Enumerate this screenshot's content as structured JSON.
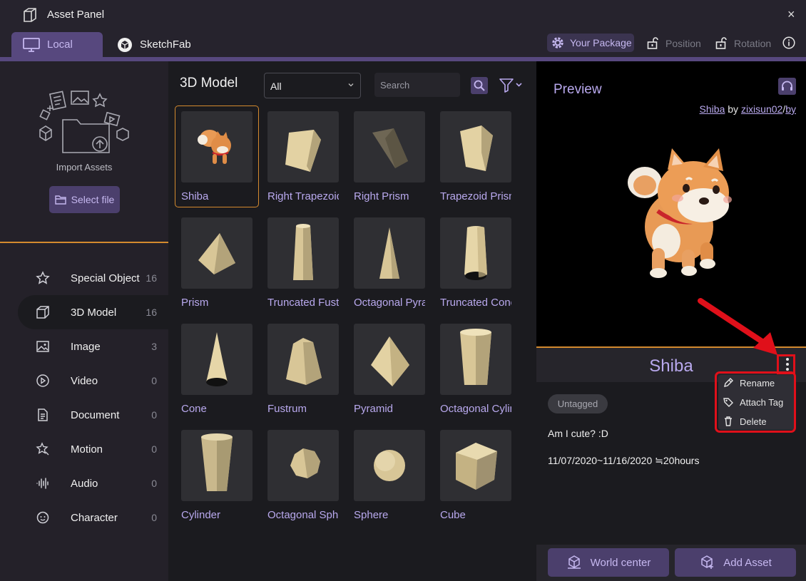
{
  "window": {
    "title": "Asset Panel",
    "close_glyph": "×"
  },
  "tabs": [
    {
      "label": "Local",
      "icon": "monitor-icon",
      "active": true
    },
    {
      "label": "SketchFab",
      "icon": "sketchfab-icon",
      "active": false
    }
  ],
  "toolbar": {
    "package_label": "Your Package",
    "position_label": "Position",
    "rotation_label": "Rotation"
  },
  "sidebar": {
    "import_label": "Import Assets",
    "select_file_label": "Select file",
    "categories": [
      {
        "label": "Special Object",
        "count": "16",
        "icon": "star-icon"
      },
      {
        "label": "3D Model",
        "count": "16",
        "icon": "cube-icon",
        "active": true
      },
      {
        "label": "Image",
        "count": "3",
        "icon": "image-icon"
      },
      {
        "label": "Video",
        "count": "0",
        "icon": "play-icon"
      },
      {
        "label": "Document",
        "count": "0",
        "icon": "document-icon"
      },
      {
        "label": "Motion",
        "count": "0",
        "icon": "motion-icon"
      },
      {
        "label": "Audio",
        "count": "0",
        "icon": "audio-icon"
      },
      {
        "label": "Character",
        "count": "0",
        "icon": "character-icon"
      }
    ]
  },
  "main": {
    "title": "3D Model",
    "filter_value": "All",
    "search_placeholder": "Search",
    "items": [
      {
        "label": "Shiba",
        "shape": "shiba",
        "selected": true
      },
      {
        "label": "Right Trapezoid",
        "shape": "right-trapezoid"
      },
      {
        "label": "Right Prism",
        "shape": "right-prism"
      },
      {
        "label": "Trapezoid Prism",
        "shape": "trapezoid-prism"
      },
      {
        "label": "Prism",
        "shape": "prism"
      },
      {
        "label": "Truncated Fustrum",
        "shape": "truncated-fustrum"
      },
      {
        "label": "Octagonal Pyramid",
        "shape": "octagonal-pyramid"
      },
      {
        "label": "Truncated Cone",
        "shape": "truncated-cone"
      },
      {
        "label": "Cone",
        "shape": "cone"
      },
      {
        "label": "Fustrum",
        "shape": "fustrum"
      },
      {
        "label": "Pyramid",
        "shape": "pyramid"
      },
      {
        "label": "Octagonal Cylinder",
        "shape": "octagonal-cylinder"
      },
      {
        "label": "Cylinder",
        "shape": "cylinder"
      },
      {
        "label": "Octagonal Sphere",
        "shape": "octagonal-sphere"
      },
      {
        "label": "Sphere",
        "shape": "sphere"
      },
      {
        "label": "Cube",
        "shape": "cube"
      }
    ]
  },
  "preview": {
    "title": "Preview",
    "credit_name": "Shiba",
    "credit_by": "by",
    "credit_author": "zixisun02",
    "credit_sep": "/",
    "credit_license": "by",
    "asset_name": "Shiba",
    "tag": "Untagged",
    "description": "Am I cute? :D",
    "date_range": "11/07/2020~11/16/2020 ≒20hours"
  },
  "context_menu": {
    "items": [
      {
        "label": "Rename",
        "icon": "pencil-icon"
      },
      {
        "label": "Attach Tag",
        "icon": "tag-icon"
      },
      {
        "label": "Delete",
        "icon": "trash-icon"
      }
    ]
  },
  "footer": {
    "world_center_label": "World center",
    "add_asset_label": "Add Asset"
  },
  "colors": {
    "accent": "#57487e",
    "accent_text": "#b9a9ee",
    "highlight": "#d48a2e",
    "annotation": "#e0101a"
  }
}
